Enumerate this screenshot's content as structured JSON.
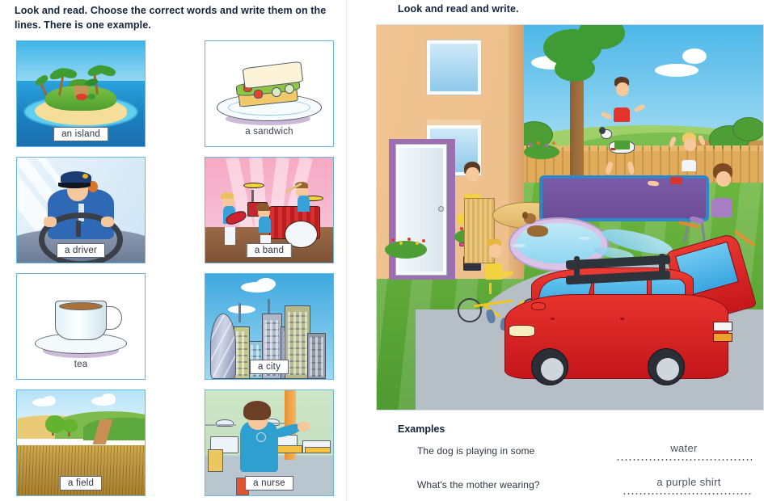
{
  "left": {
    "instruction": "Look and read. Choose the correct words and write them on the lines. There is one example.",
    "cards": [
      {
        "label": "an island",
        "style": "boxed",
        "icon": "island-illustration"
      },
      {
        "label": "a sandwich",
        "style": "plain",
        "icon": "sandwich-illustration"
      },
      {
        "label": "a driver",
        "style": "boxed",
        "icon": "driver-illustration"
      },
      {
        "label": "a band",
        "style": "boxed",
        "icon": "band-illustration"
      },
      {
        "label": "tea",
        "style": "plain",
        "icon": "tea-illustration"
      },
      {
        "label": "a city",
        "style": "boxed",
        "icon": "city-illustration"
      },
      {
        "label": "a field",
        "style": "boxed",
        "icon": "field-illustration"
      },
      {
        "label": "a nurse",
        "style": "boxed",
        "icon": "nurse-illustration"
      }
    ]
  },
  "right": {
    "instruction": "Look and read and write.",
    "scene": {
      "name": "garden-scene-illustration",
      "description": "A family garden scene with a house, a girl carrying a tray of drinks, a dog, a tree, a wooden fence, children on a trampoline, a mother watering a paddling pool with a hose, a dog in the paddling pool, a boy on a yellow bicycle and a red car with its boot open."
    },
    "examples": {
      "title": "Examples",
      "rows": [
        {
          "question": "The dog is playing in some",
          "answer": "water"
        },
        {
          "question": "What's the mother wearing?",
          "answer": "a purple shirt"
        }
      ]
    }
  },
  "colors": {
    "card_border": "#63b9e3",
    "heading_text": "#13253c",
    "body_text": "#2c3443",
    "answer_text": "#4a5260",
    "divider": "#f0e6dd"
  }
}
